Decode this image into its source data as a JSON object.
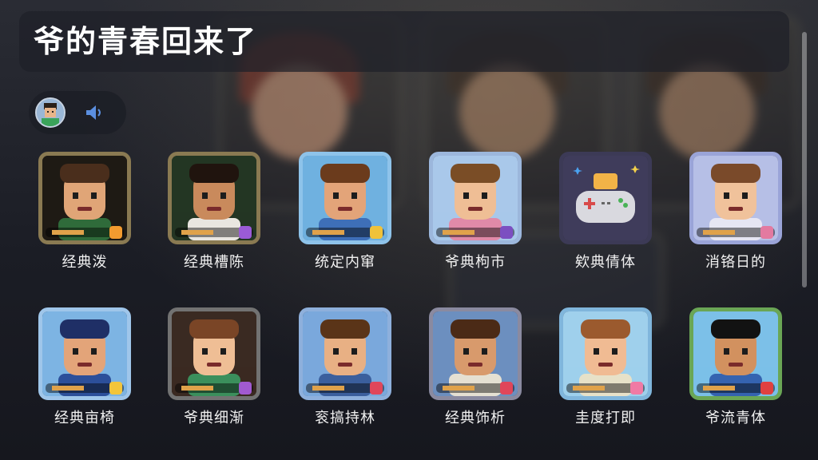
{
  "header": {
    "title": "爷的青春回来了"
  },
  "controls": {
    "avatar": "avatar",
    "sound_icon": "speaker-icon"
  },
  "games": [
    {
      "label": "经典泼",
      "frame": "#8a7a52",
      "bg": "#1e1a14",
      "skin": "#e0a577",
      "hair": "#4a2e1c",
      "shirt": "#2f6b3a",
      "badge": "#f39b2f"
    },
    {
      "label": "经典槽陈",
      "frame": "#8a7a52",
      "bg": "#233623",
      "skin": "#c98a5c",
      "hair": "#20140e",
      "shirt": "#e9e6e0",
      "badge": "#9a5bd6"
    },
    {
      "label": "统定内窜",
      "frame": "#8ec3ea",
      "bg": "#6fb1e0",
      "skin": "#e3a479",
      "hair": "#6b3b1c",
      "shirt": "#3e6fb8",
      "badge": "#f0c23a"
    },
    {
      "label": "爷典枸市",
      "frame": "#9cb7dc",
      "bg": "#a9c8ea",
      "skin": "#efbe95",
      "hair": "#7a4d26",
      "shirt": "#e08aa8",
      "badge": "#7c4fc1"
    },
    {
      "label": "欸典倩体",
      "frame": "#3c3a56",
      "bg": "#3f3c5b",
      "skin": "#f2b347",
      "hair": "#e7e7ec",
      "shirt": "#d9d9df",
      "badge": "#4aa2f0"
    },
    {
      "label": "消铬日的",
      "frame": "#9aa4d8",
      "bg": "#b6bfe6",
      "skin": "#f0c29b",
      "hair": "#7a4a2a",
      "shirt": "#e6e6f3",
      "badge": "#e37aa0"
    },
    {
      "label": "经典亩椅",
      "frame": "#9fc6ea",
      "bg": "#7db4e3",
      "skin": "#e3a479",
      "hair": "#1f2f66",
      "shirt": "#2c4f9a",
      "badge": "#f3c53b"
    },
    {
      "label": "爷典细渐",
      "frame": "#727272",
      "bg": "#3a2a22",
      "skin": "#efbe95",
      "hair": "#7a4526",
      "shirt": "#3b8f5c",
      "badge": "#a15ad0"
    },
    {
      "label": "衮搞持林",
      "frame": "#8eb0dc",
      "bg": "#7aa8dc",
      "skin": "#e8b084",
      "hair": "#5a3418",
      "shirt": "#3b5f9d",
      "badge": "#e0465a"
    },
    {
      "label": "经典饰析",
      "frame": "#8a8aa0",
      "bg": "#6c8fbf",
      "skin": "#d89a6c",
      "hair": "#4b2a16",
      "shirt": "#e5e0d2",
      "badge": "#e0465a"
    },
    {
      "label": "圭度打即",
      "frame": "#80b6dc",
      "bg": "#9fd0ec",
      "skin": "#f0bb93",
      "hair": "#9b5a2e",
      "shirt": "#e7e1c8",
      "badge": "#f07aa4"
    },
    {
      "label": "爷流青体",
      "frame": "#6aa655",
      "bg": "#7cc0e8",
      "skin": "#d2915f",
      "hair": "#121212",
      "shirt": "#3563b0",
      "badge": "#e04040"
    }
  ]
}
